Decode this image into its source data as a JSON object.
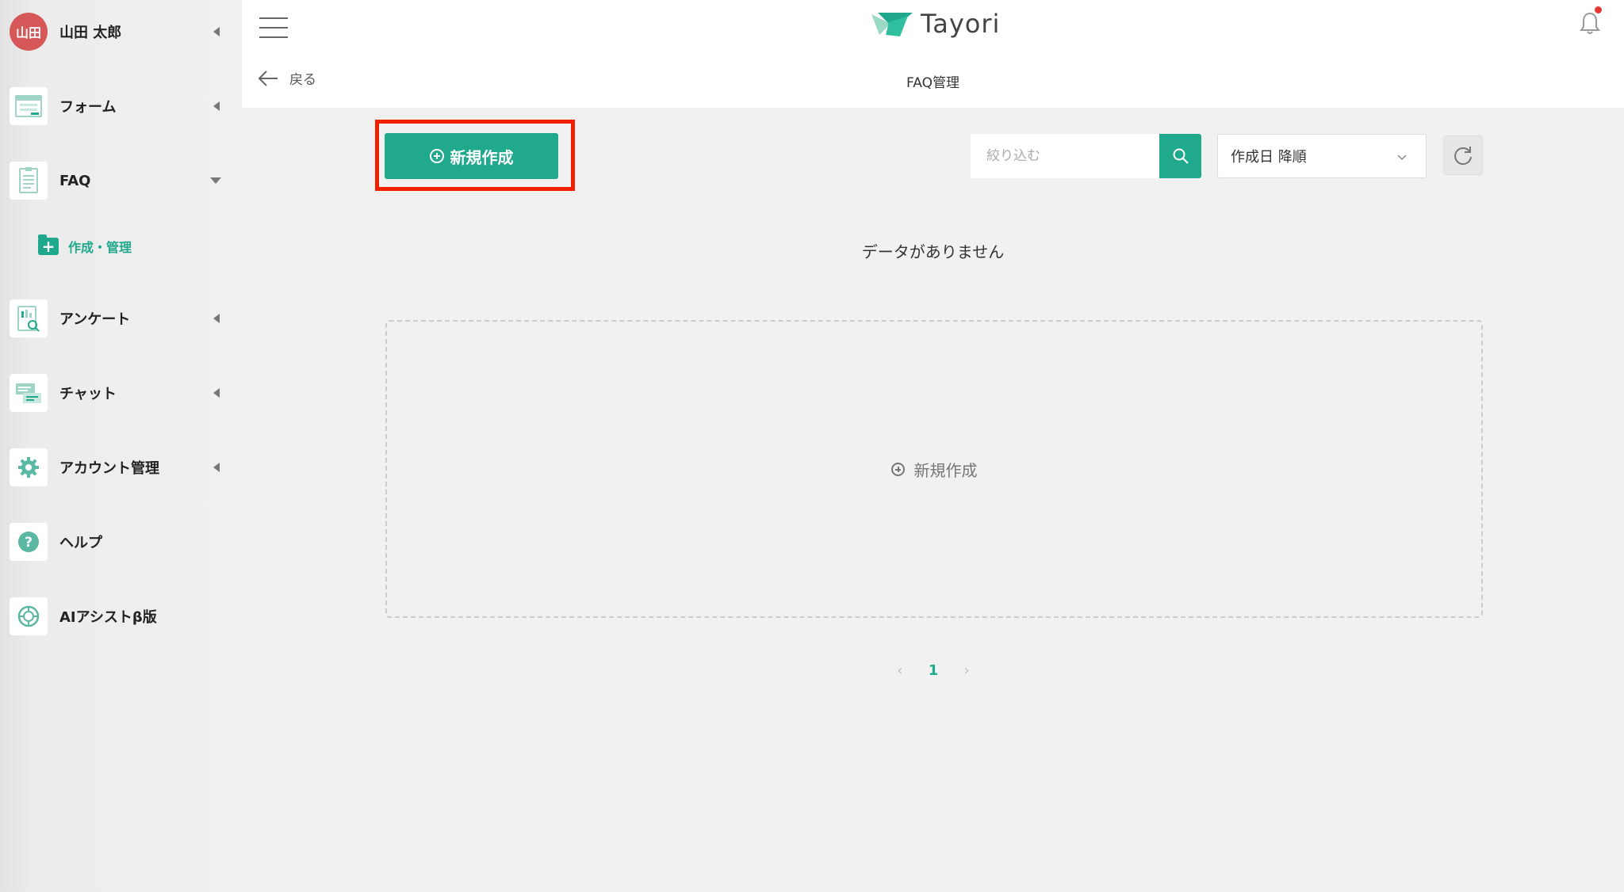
{
  "user": {
    "avatar_text": "山田",
    "name": "山田 太郎"
  },
  "sidebar": {
    "items": [
      {
        "label": "フォーム"
      },
      {
        "label": "FAQ"
      },
      {
        "label": "アンケート"
      },
      {
        "label": "チャット"
      },
      {
        "label": "アカウント管理"
      },
      {
        "label": "ヘルプ"
      },
      {
        "label": "AIアシストβ版"
      }
    ],
    "faq_sub_item": {
      "label": "作成・管理"
    }
  },
  "header": {
    "logo_text": "Tayori",
    "back_label": "戻る",
    "page_title": "FAQ管理"
  },
  "toolbar": {
    "new_button_label": "新規作成",
    "filter_placeholder": "絞り込む",
    "sort_selected": "作成日 降順"
  },
  "main": {
    "empty_message": "データがありません",
    "create_card_label": "新規作成"
  },
  "pagination": {
    "current_page": "1",
    "prev": "‹",
    "next": "›"
  },
  "colors": {
    "accent": "#21a98e",
    "highlight_border": "#f02000",
    "avatar_bg": "#d65757",
    "notification_dot": "#e53935"
  }
}
